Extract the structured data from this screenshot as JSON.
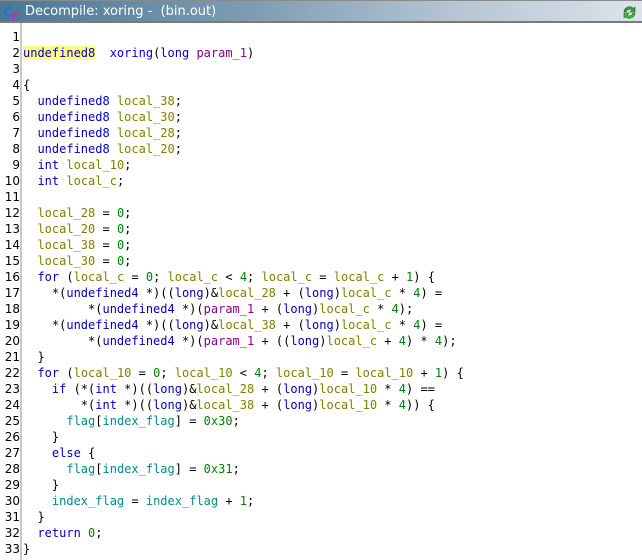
{
  "window": {
    "title": "Decompile: xoring -  (bin.out)",
    "icon": "decompiler-cf-icon",
    "refresh_icon": "refresh-icon"
  },
  "colors": {
    "keyword": "#0000c0",
    "function": "#0000ff",
    "parameter": "#8b008b",
    "local_variable": "#808000",
    "global_variable": "#008b8b",
    "constant": "#008000",
    "highlight": "#ffff80"
  },
  "code": {
    "highlighted_token": "undefined8",
    "lines": [
      {
        "n": "1",
        "tokens": []
      },
      {
        "n": "2",
        "tokens": [
          [
            "hl typ",
            "undefined8"
          ],
          [
            "",
            "  "
          ],
          [
            "fn",
            "xoring"
          ],
          [
            "",
            "("
          ],
          [
            "typ",
            "long"
          ],
          [
            "",
            " "
          ],
          [
            "par",
            "param_1"
          ],
          [
            "",
            ")"
          ]
        ]
      },
      {
        "n": "3",
        "tokens": []
      },
      {
        "n": "4",
        "tokens": [
          [
            "",
            "{"
          ]
        ]
      },
      {
        "n": "5",
        "tokens": [
          [
            "",
            "  "
          ],
          [
            "typ",
            "undefined8"
          ],
          [
            "",
            " "
          ],
          [
            "var",
            "local_38"
          ],
          [
            "",
            ";"
          ]
        ]
      },
      {
        "n": "6",
        "tokens": [
          [
            "",
            "  "
          ],
          [
            "typ",
            "undefined8"
          ],
          [
            "",
            " "
          ],
          [
            "var",
            "local_30"
          ],
          [
            "",
            ";"
          ]
        ]
      },
      {
        "n": "7",
        "tokens": [
          [
            "",
            "  "
          ],
          [
            "typ",
            "undefined8"
          ],
          [
            "",
            " "
          ],
          [
            "var",
            "local_28"
          ],
          [
            "",
            ";"
          ]
        ]
      },
      {
        "n": "8",
        "tokens": [
          [
            "",
            "  "
          ],
          [
            "typ",
            "undefined8"
          ],
          [
            "",
            " "
          ],
          [
            "var",
            "local_20"
          ],
          [
            "",
            ";"
          ]
        ]
      },
      {
        "n": "9",
        "tokens": [
          [
            "",
            "  "
          ],
          [
            "typ",
            "int"
          ],
          [
            "",
            " "
          ],
          [
            "var",
            "local_10"
          ],
          [
            "",
            ";"
          ]
        ]
      },
      {
        "n": "10",
        "tokens": [
          [
            "",
            "  "
          ],
          [
            "typ",
            "int"
          ],
          [
            "",
            " "
          ],
          [
            "var",
            "local_c"
          ],
          [
            "",
            ";"
          ]
        ]
      },
      {
        "n": "11",
        "tokens": []
      },
      {
        "n": "12",
        "tokens": [
          [
            "",
            "  "
          ],
          [
            "var",
            "local_28"
          ],
          [
            "",
            " = "
          ],
          [
            "num",
            "0"
          ],
          [
            "",
            ";"
          ]
        ]
      },
      {
        "n": "13",
        "tokens": [
          [
            "",
            "  "
          ],
          [
            "var",
            "local_20"
          ],
          [
            "",
            " = "
          ],
          [
            "num",
            "0"
          ],
          [
            "",
            ";"
          ]
        ]
      },
      {
        "n": "14",
        "tokens": [
          [
            "",
            "  "
          ],
          [
            "var",
            "local_38"
          ],
          [
            "",
            " = "
          ],
          [
            "num",
            "0"
          ],
          [
            "",
            ";"
          ]
        ]
      },
      {
        "n": "15",
        "tokens": [
          [
            "",
            "  "
          ],
          [
            "var",
            "local_30"
          ],
          [
            "",
            " = "
          ],
          [
            "num",
            "0"
          ],
          [
            "",
            ";"
          ]
        ]
      },
      {
        "n": "16",
        "tokens": [
          [
            "",
            "  "
          ],
          [
            "kw",
            "for"
          ],
          [
            "",
            " ("
          ],
          [
            "var",
            "local_c"
          ],
          [
            "",
            " = "
          ],
          [
            "num",
            "0"
          ],
          [
            "",
            "; "
          ],
          [
            "var",
            "local_c"
          ],
          [
            "",
            " < "
          ],
          [
            "num",
            "4"
          ],
          [
            "",
            "; "
          ],
          [
            "var",
            "local_c"
          ],
          [
            "",
            " = "
          ],
          [
            "var",
            "local_c"
          ],
          [
            "",
            " + "
          ],
          [
            "num",
            "1"
          ],
          [
            "",
            ") {"
          ]
        ]
      },
      {
        "n": "17",
        "tokens": [
          [
            "",
            "    *("
          ],
          [
            "typ",
            "undefined4"
          ],
          [
            "",
            " *)(("
          ],
          [
            "typ",
            "long"
          ],
          [
            "",
            ")&"
          ],
          [
            "var",
            "local_28"
          ],
          [
            "",
            " + ("
          ],
          [
            "typ",
            "long"
          ],
          [
            "",
            ")"
          ],
          [
            "var",
            "local_c"
          ],
          [
            "",
            " * "
          ],
          [
            "num",
            "4"
          ],
          [
            "",
            ") ="
          ]
        ]
      },
      {
        "n": "18",
        "tokens": [
          [
            "",
            "         *("
          ],
          [
            "typ",
            "undefined4"
          ],
          [
            "",
            " *)("
          ],
          [
            "par",
            "param_1"
          ],
          [
            "",
            " + ("
          ],
          [
            "typ",
            "long"
          ],
          [
            "",
            ")"
          ],
          [
            "var",
            "local_c"
          ],
          [
            "",
            " * "
          ],
          [
            "num",
            "4"
          ],
          [
            "",
            ");"
          ]
        ]
      },
      {
        "n": "19",
        "tokens": [
          [
            "",
            "    *("
          ],
          [
            "typ",
            "undefined4"
          ],
          [
            "",
            " *)(("
          ],
          [
            "typ",
            "long"
          ],
          [
            "",
            ")&"
          ],
          [
            "var",
            "local_38"
          ],
          [
            "",
            " + ("
          ],
          [
            "typ",
            "long"
          ],
          [
            "",
            ")"
          ],
          [
            "var",
            "local_c"
          ],
          [
            "",
            " * "
          ],
          [
            "num",
            "4"
          ],
          [
            "",
            ") ="
          ]
        ]
      },
      {
        "n": "20",
        "tokens": [
          [
            "",
            "         *("
          ],
          [
            "typ",
            "undefined4"
          ],
          [
            "",
            " *)("
          ],
          [
            "par",
            "param_1"
          ],
          [
            "",
            " + (("
          ],
          [
            "typ",
            "long"
          ],
          [
            "",
            ")"
          ],
          [
            "var",
            "local_c"
          ],
          [
            "",
            " + "
          ],
          [
            "num",
            "4"
          ],
          [
            "",
            ") * "
          ],
          [
            "num",
            "4"
          ],
          [
            "",
            ");"
          ]
        ]
      },
      {
        "n": "21",
        "tokens": [
          [
            "",
            "  }"
          ]
        ]
      },
      {
        "n": "22",
        "tokens": [
          [
            "",
            "  "
          ],
          [
            "kw",
            "for"
          ],
          [
            "",
            " ("
          ],
          [
            "var",
            "local_10"
          ],
          [
            "",
            " = "
          ],
          [
            "num",
            "0"
          ],
          [
            "",
            "; "
          ],
          [
            "var",
            "local_10"
          ],
          [
            "",
            " < "
          ],
          [
            "num",
            "4"
          ],
          [
            "",
            "; "
          ],
          [
            "var",
            "local_10"
          ],
          [
            "",
            " = "
          ],
          [
            "var",
            "local_10"
          ],
          [
            "",
            " + "
          ],
          [
            "num",
            "1"
          ],
          [
            "",
            ") {"
          ]
        ]
      },
      {
        "n": "23",
        "tokens": [
          [
            "",
            "    "
          ],
          [
            "kw",
            "if"
          ],
          [
            "",
            " (*("
          ],
          [
            "typ",
            "int"
          ],
          [
            "",
            " *)(("
          ],
          [
            "typ",
            "long"
          ],
          [
            "",
            ")&"
          ],
          [
            "var",
            "local_28"
          ],
          [
            "",
            " + ("
          ],
          [
            "typ",
            "long"
          ],
          [
            "",
            ")"
          ],
          [
            "var",
            "local_10"
          ],
          [
            "",
            " * "
          ],
          [
            "num",
            "4"
          ],
          [
            "",
            ") =="
          ]
        ]
      },
      {
        "n": "24",
        "tokens": [
          [
            "",
            "        *("
          ],
          [
            "typ",
            "int"
          ],
          [
            "",
            " *)(("
          ],
          [
            "typ",
            "long"
          ],
          [
            "",
            ")&"
          ],
          [
            "var",
            "local_38"
          ],
          [
            "",
            " + ("
          ],
          [
            "typ",
            "long"
          ],
          [
            "",
            ")"
          ],
          [
            "var",
            "local_10"
          ],
          [
            "",
            " * "
          ],
          [
            "num",
            "4"
          ],
          [
            "",
            ")) {"
          ]
        ]
      },
      {
        "n": "25",
        "tokens": [
          [
            "",
            "      "
          ],
          [
            "glob",
            "flag"
          ],
          [
            "",
            "["
          ],
          [
            "glob",
            "index_flag"
          ],
          [
            "",
            "] = "
          ],
          [
            "num",
            "0x30"
          ],
          [
            "",
            ";"
          ]
        ]
      },
      {
        "n": "26",
        "tokens": [
          [
            "",
            "    }"
          ]
        ]
      },
      {
        "n": "27",
        "tokens": [
          [
            "",
            "    "
          ],
          [
            "kw",
            "else"
          ],
          [
            "",
            " {"
          ]
        ]
      },
      {
        "n": "28",
        "tokens": [
          [
            "",
            "      "
          ],
          [
            "glob",
            "flag"
          ],
          [
            "",
            "["
          ],
          [
            "glob",
            "index_flag"
          ],
          [
            "",
            "] = "
          ],
          [
            "num",
            "0x31"
          ],
          [
            "",
            ";"
          ]
        ]
      },
      {
        "n": "29",
        "tokens": [
          [
            "",
            "    }"
          ]
        ]
      },
      {
        "n": "30",
        "tokens": [
          [
            "",
            "    "
          ],
          [
            "glob",
            "index_flag"
          ],
          [
            "",
            " = "
          ],
          [
            "glob",
            "index_flag"
          ],
          [
            "",
            " + "
          ],
          [
            "num",
            "1"
          ],
          [
            "",
            ";"
          ]
        ]
      },
      {
        "n": "31",
        "tokens": [
          [
            "",
            "  }"
          ]
        ]
      },
      {
        "n": "32",
        "tokens": [
          [
            "",
            "  "
          ],
          [
            "kw",
            "return"
          ],
          [
            "",
            " "
          ],
          [
            "num",
            "0"
          ],
          [
            "",
            ";"
          ]
        ]
      },
      {
        "n": "33",
        "tokens": [
          [
            "",
            "}"
          ]
        ]
      }
    ]
  }
}
